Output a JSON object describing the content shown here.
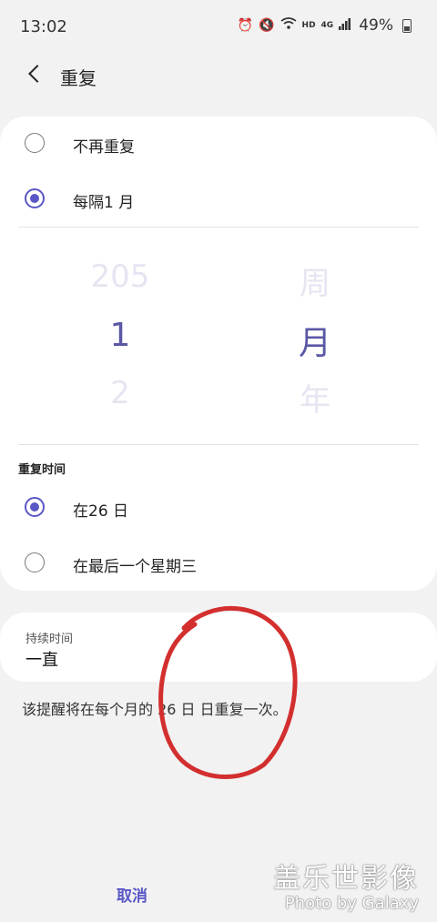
{
  "status_bar": {
    "time": "13:02",
    "network": "HD",
    "signal": "4G",
    "battery": "49%"
  },
  "header": {
    "title": "重复"
  },
  "repeat_options": [
    {
      "label": "不再重复",
      "selected": false
    },
    {
      "label": "每隔1 月",
      "selected": true
    }
  ],
  "picker": {
    "number": {
      "above": "205",
      "selected": "1",
      "below": "2"
    },
    "unit": {
      "above": "周",
      "selected": "月",
      "below": "年"
    }
  },
  "repeat_time": {
    "section_label": "重复时间",
    "options": [
      {
        "label": "在26 日",
        "selected": true
      },
      {
        "label": "在最后一个星期三",
        "selected": false
      }
    ]
  },
  "duration": {
    "label": "持续时间",
    "value": "一直"
  },
  "description": "该提醒将在每个月的 26 日 日重复一次。",
  "footer": {
    "cancel_label": "取消"
  },
  "watermark": {
    "line1": "盖乐世影像",
    "line2": "Photo by Galaxy"
  },
  "colors": {
    "accent": "#5a57c6",
    "annotation": "#d32f2f",
    "background": "#f2f2f2"
  }
}
